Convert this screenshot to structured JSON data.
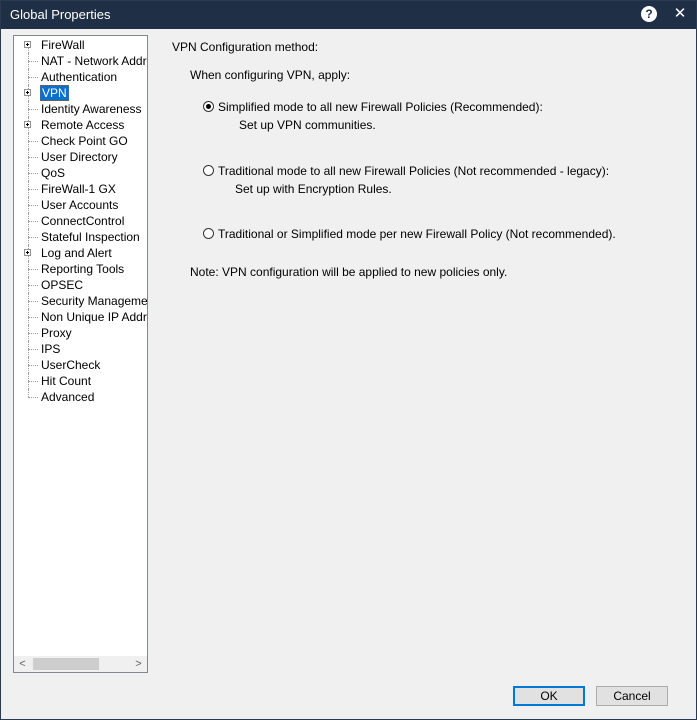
{
  "window": {
    "title": "Global Properties",
    "help_icon": "?",
    "close_icon": "✕"
  },
  "tree": {
    "items": [
      {
        "label": "FireWall",
        "expandable": true
      },
      {
        "label": "NAT - Network Address Translation",
        "expandable": false
      },
      {
        "label": "Authentication",
        "expandable": false
      },
      {
        "label": "VPN",
        "expandable": true,
        "selected": true
      },
      {
        "label": "Identity Awareness",
        "expandable": false
      },
      {
        "label": "Remote Access",
        "expandable": true
      },
      {
        "label": "Check Point GO",
        "expandable": false
      },
      {
        "label": "User Directory",
        "expandable": false
      },
      {
        "label": "QoS",
        "expandable": false
      },
      {
        "label": "FireWall-1 GX",
        "expandable": false
      },
      {
        "label": "User Accounts",
        "expandable": false
      },
      {
        "label": "ConnectControl",
        "expandable": false
      },
      {
        "label": "Stateful Inspection",
        "expandable": false
      },
      {
        "label": "Log and Alert",
        "expandable": true
      },
      {
        "label": "Reporting Tools",
        "expandable": false
      },
      {
        "label": "OPSEC",
        "expandable": false
      },
      {
        "label": "Security Management Access",
        "expandable": false
      },
      {
        "label": "Non Unique IP Address Ranges",
        "expandable": false
      },
      {
        "label": "Proxy",
        "expandable": false
      },
      {
        "label": "IPS",
        "expandable": false
      },
      {
        "label": "UserCheck",
        "expandable": false
      },
      {
        "label": "Hit Count",
        "expandable": false
      },
      {
        "label": "Advanced",
        "expandable": false
      }
    ],
    "scroll_left": "<",
    "scroll_right": ">"
  },
  "vpn": {
    "section_title": "VPN Configuration method:",
    "apply_label": "When configuring VPN, apply:",
    "options": [
      {
        "label": "Simplified mode to all new Firewall Policies (Recommended):",
        "description": "Set up VPN communities.",
        "checked": true
      },
      {
        "label": "Traditional mode to all new Firewall Policies (Not recommended - legacy):",
        "description": "Set up with Encryption Rules.",
        "checked": false
      },
      {
        "label": "Traditional or Simplified mode per new Firewall Policy (Not recommended).",
        "description": "",
        "checked": false
      }
    ],
    "note": "Note: VPN configuration will be applied to new policies only."
  },
  "buttons": {
    "ok": "OK",
    "cancel": "Cancel"
  }
}
